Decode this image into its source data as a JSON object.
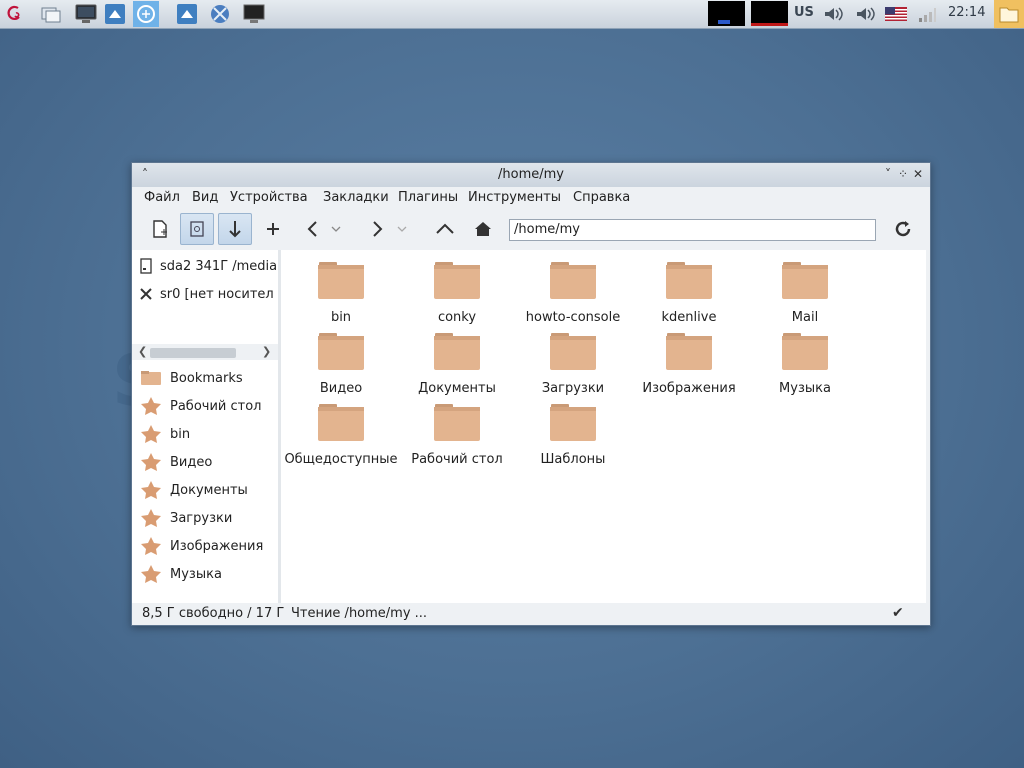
{
  "panel": {
    "launchers": [
      "debian-logo-icon",
      "show-desktop-icon",
      "monitor-icon",
      "file-manager-icon",
      "browser-icon",
      "file-manager-icon-2",
      "browser-icon-2",
      "terminal-icon"
    ],
    "keyboard_layout": "US",
    "clock": "22:14"
  },
  "desktop": {
    "watermark": "S"
  },
  "window": {
    "title": "/home/my",
    "menu": [
      "Файл",
      "Вид",
      "Устройства",
      "Закладки",
      "Плагины",
      "Инструменты",
      "Справка"
    ],
    "path": "/home/my",
    "devices": [
      {
        "label": "sda2 341Г /media",
        "icon": "drive-icon"
      },
      {
        "label": "sr0 [нет носител",
        "icon": "eject-x-icon"
      }
    ],
    "bookmarks_title": "Bookmarks",
    "bookmarks": [
      "Рабочий стол",
      "bin",
      "Видео",
      "Документы",
      "Загрузки",
      "Изображения",
      "Музыка"
    ],
    "files": [
      "bin",
      "conky",
      "howto-console",
      "kdenlive",
      "Mail",
      "Видео",
      "Документы",
      "Загрузки",
      "Изображения",
      "Музыка",
      "Общедоступные",
      "Рабочий стол",
      "Шаблоны"
    ],
    "status": {
      "free": "8,5 Г свободно / 17 Г",
      "message": "Чтение /home/my ..."
    }
  },
  "colors": {
    "folder": "#e3b48f",
    "bookmark_star": "#d99c72",
    "accent": "#9ab4cf"
  }
}
